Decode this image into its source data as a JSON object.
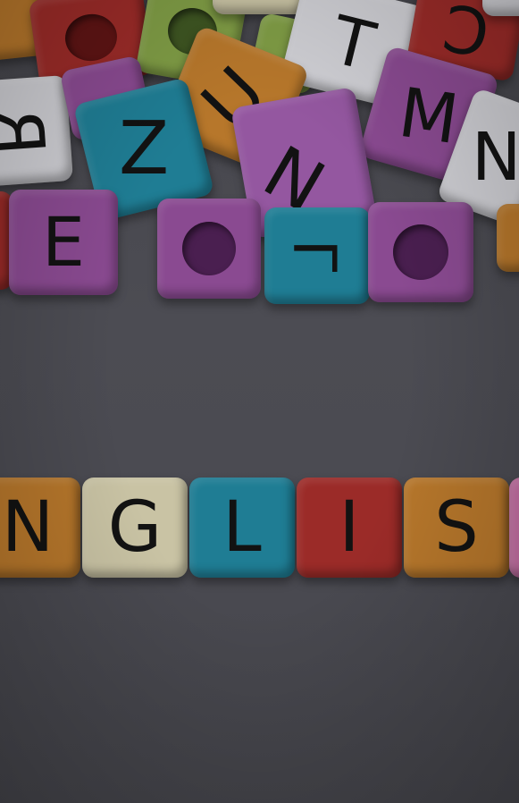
{
  "photo": {
    "subject": "letter-beads",
    "colors": {
      "red": "#9b2b28",
      "orange": "#b7772b",
      "cream": "#c9c3a4",
      "cyan": "#1f7d94",
      "purple": "#8a4a91",
      "lime": "#7f9c45",
      "white": "#cfcfd4"
    },
    "word_row": [
      "N",
      "G",
      "L",
      "I",
      "S"
    ],
    "pile_letters": [
      "T",
      "C",
      "R",
      "M",
      "N",
      "U",
      "Z",
      "E",
      "N",
      "L"
    ]
  }
}
